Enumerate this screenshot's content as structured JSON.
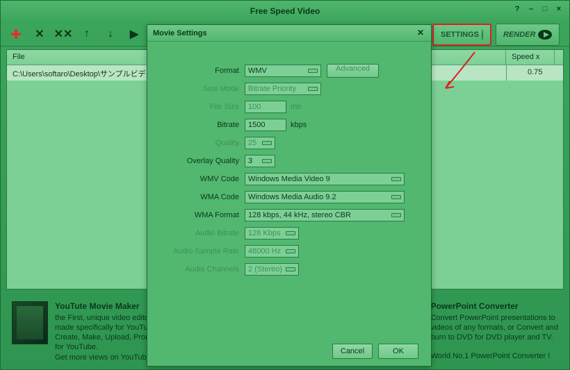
{
  "window": {
    "title": "Free Speed Video"
  },
  "toolbar": {
    "settings": "SETTINGS",
    "render": "RENDER"
  },
  "table": {
    "headers": {
      "file": "File",
      "speedx": "Speed x"
    },
    "rows": [
      {
        "file": "C:\\Users\\softaro\\Desktop\\サンプルビデオ",
        "speedx": "0.75"
      }
    ]
  },
  "dialog": {
    "title": "Movie Settings",
    "fields": {
      "format": {
        "label": "Format",
        "value": "WMV",
        "btn": "Advanced"
      },
      "sizemode": {
        "label": "Size Mode",
        "value": "Bitrate Priority"
      },
      "filesize": {
        "label": "File Size",
        "value": "100",
        "unit": "mb"
      },
      "bitrate": {
        "label": "Bitrate",
        "value": "1500",
        "unit": "kbps"
      },
      "quality": {
        "label": "Quality",
        "value": "25"
      },
      "overlayq": {
        "label": "Overlay Quality",
        "value": "3"
      },
      "wmvcode": {
        "label": "WMV Code",
        "value": "Windows Media Video 9"
      },
      "wmacode": {
        "label": "WMA Code",
        "value": "Windows Media Audio 9.2"
      },
      "wmaformat": {
        "label": "WMA Format",
        "value": "128 kbps, 44 kHz, stereo CBR"
      },
      "audiobitrate": {
        "label": "Audio Bitrate",
        "value": "128 Kbps"
      },
      "audiosample": {
        "label": "Audio Sample Rate",
        "value": "48000 Hz"
      },
      "audiochannels": {
        "label": "Audio Channels",
        "value": "2 (Stereo)"
      }
    },
    "buttons": {
      "cancel": "Cancel",
      "ok": "OK"
    }
  },
  "promo": {
    "p1": {
      "title": "YouTute Movie Maker",
      "line1": "the First, unique video editor",
      "line2": "made specifically for YouTube.",
      "line3": "Create, Make, Upload, Promote",
      "line4": "for YouTube.",
      "line5": "Get more views on YouTube."
    },
    "p2": {
      "title": "PowerPoint Converter",
      "line1": "Convert PowerPoint presentations to",
      "line2": "videos of any formats, or Convert and",
      "line3": "burn to DVD for DVD player and TV.",
      "line4": "",
      "line5": "World No.1 PowerPoint Converter !"
    }
  }
}
